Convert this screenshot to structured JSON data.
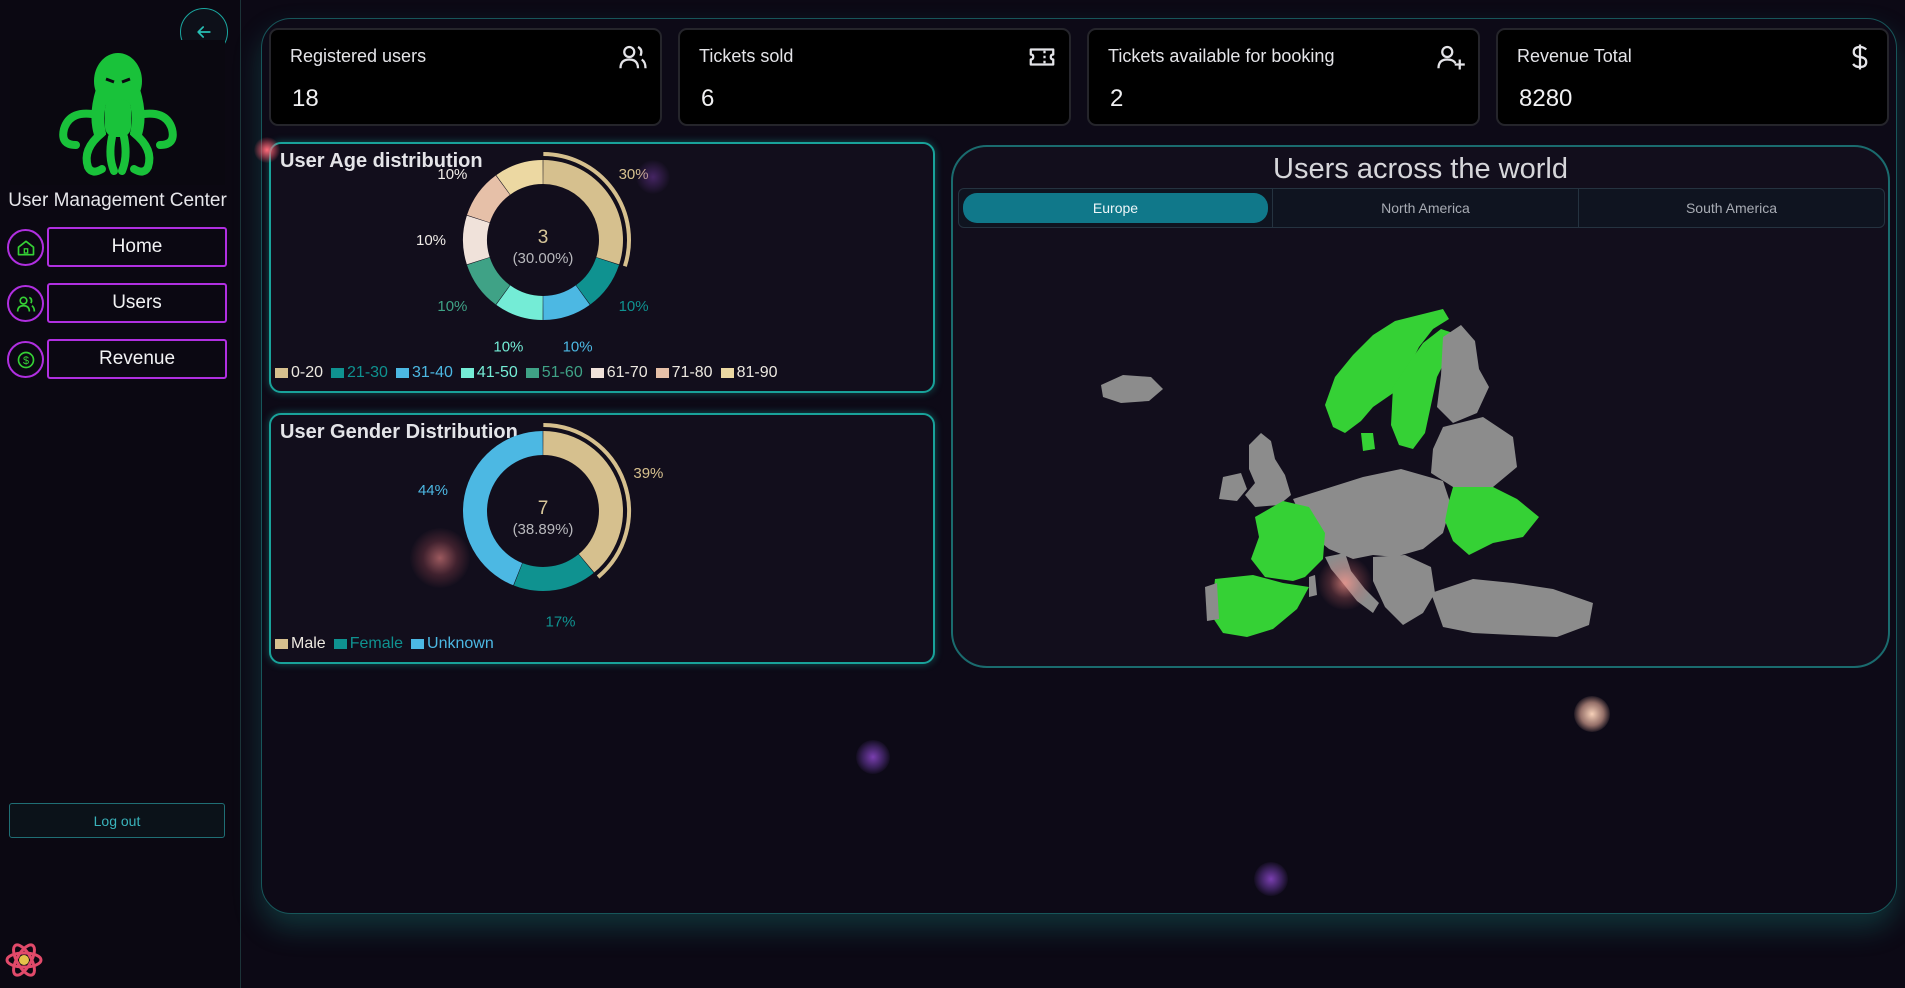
{
  "sidebar": {
    "brand": "User Management Center",
    "nav": [
      {
        "label": "Home",
        "icon": "home-icon"
      },
      {
        "label": "Users",
        "icon": "users-icon"
      },
      {
        "label": "Revenue",
        "icon": "dollar-icon"
      }
    ],
    "logout_label": "Log out"
  },
  "kpis": [
    {
      "label": "Registered users",
      "value": "18",
      "icon": "users-icon"
    },
    {
      "label": "Tickets sold",
      "value": "6",
      "icon": "ticket-icon"
    },
    {
      "label": "Tickets available for booking",
      "value": "2",
      "icon": "user-plus-icon"
    },
    {
      "label": "Revenue Total",
      "value": "8280",
      "icon": "dollar-icon"
    }
  ],
  "age_chart": {
    "title": "User Age distribution",
    "center_value": "3",
    "center_sub": "(30.00%)",
    "labels": [
      "30%",
      "10%",
      "10%",
      "10%",
      "10%",
      "10%",
      "10%",
      "10%"
    ],
    "legend": [
      "0-20",
      "21-30",
      "31-40",
      "41-50",
      "51-60",
      "61-70",
      "71-80",
      "81-90"
    ]
  },
  "gender_chart": {
    "title": "User Gender Distribution",
    "center_value": "7",
    "center_sub": "(38.89%)",
    "labels": [
      "39%",
      "17%",
      "44%"
    ],
    "legend": [
      "Male",
      "Female",
      "Unknown"
    ]
  },
  "chart_data": [
    {
      "type": "pie",
      "title": "User Age distribution",
      "categories": [
        "0-20",
        "21-30",
        "31-40",
        "41-50",
        "51-60",
        "61-70",
        "71-80",
        "81-90"
      ],
      "values": [
        30,
        10,
        10,
        10,
        10,
        10,
        10,
        10
      ],
      "colors": [
        "#d6c08e",
        "#0f9290",
        "#4cb8e3",
        "#74ecd6",
        "#3fa286",
        "#f0e2da",
        "#e6c0a8",
        "#ecd8a2"
      ],
      "legend": "bottom"
    },
    {
      "type": "pie",
      "title": "User Gender Distribution",
      "categories": [
        "Male",
        "Female",
        "Unknown"
      ],
      "values": [
        39,
        17,
        44
      ],
      "colors": [
        "#d6c08e",
        "#0f9290",
        "#4cb8e3"
      ],
      "legend": "bottom"
    }
  ],
  "map": {
    "title": "Users across the world",
    "tabs": [
      "Europe",
      "North America",
      "South America"
    ],
    "active_tab": "Europe",
    "highlight_color": "#35d135",
    "base_color": "#8c8c8c"
  },
  "colors": {
    "accent_teal": "#19a29a",
    "nav_purple": "#b02fe0",
    "brand_green": "#19c23a"
  }
}
